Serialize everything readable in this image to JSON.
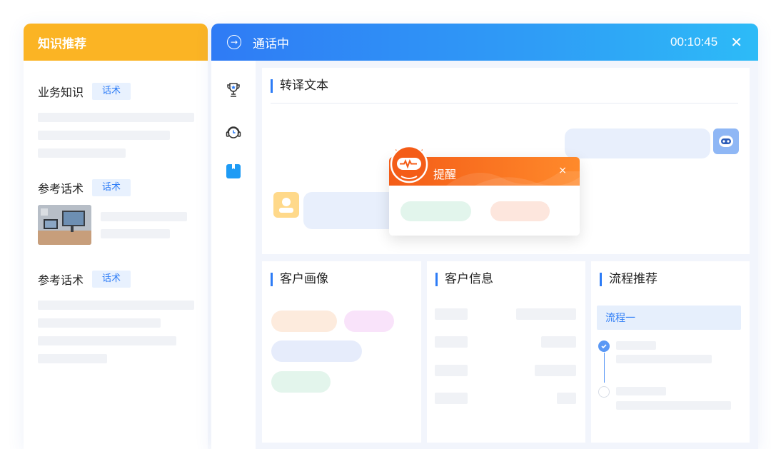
{
  "knowledge": {
    "title": "知识推荐",
    "sections": [
      {
        "title": "业务知识",
        "tag": "话术"
      },
      {
        "title": "参考话术",
        "tag": "话术"
      },
      {
        "title": "参考话术",
        "tag": "话术"
      }
    ]
  },
  "call": {
    "status": "通话中",
    "timer": "00:10:45",
    "close_label": "✕"
  },
  "toolbar": {
    "icons": [
      "trophy-icon",
      "headset-icon",
      "bookmark-icon"
    ]
  },
  "transcript": {
    "title": "转译文本"
  },
  "alert": {
    "title": "提醒",
    "close_label": "×"
  },
  "panels": {
    "profile_title": "客户画像",
    "info_title": "客户信息",
    "flow_title": "流程推荐",
    "flow_item": "流程一"
  },
  "colors": {
    "knowledge_header": "#FBB424",
    "call_header_start": "#2F7BF5",
    "call_header_end": "#2DBBF7",
    "alert_header": "#F45C17",
    "accent": "#2D7CF6"
  }
}
